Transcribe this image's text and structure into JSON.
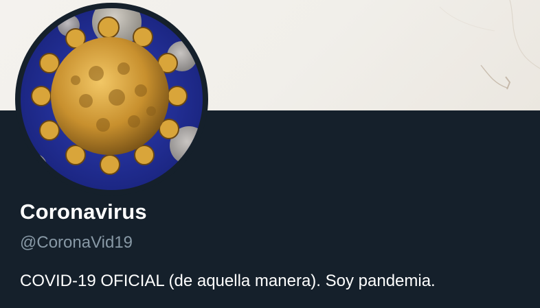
{
  "profile": {
    "display_name": "Coronavirus",
    "handle": "@CoronaVid19",
    "bio": "COVID-19 OFICIAL (de aquella manera). Soy pandemia."
  },
  "colors": {
    "background": "#15202b",
    "banner": "#f2f0eb",
    "display_name": "#ffffff",
    "handle": "#8899a6",
    "bio": "#ffffff",
    "avatar_backdrop": "#1e2a8f",
    "virus_body": "#d9a53a"
  },
  "icons": {
    "avatar": "coronavirus-image"
  }
}
